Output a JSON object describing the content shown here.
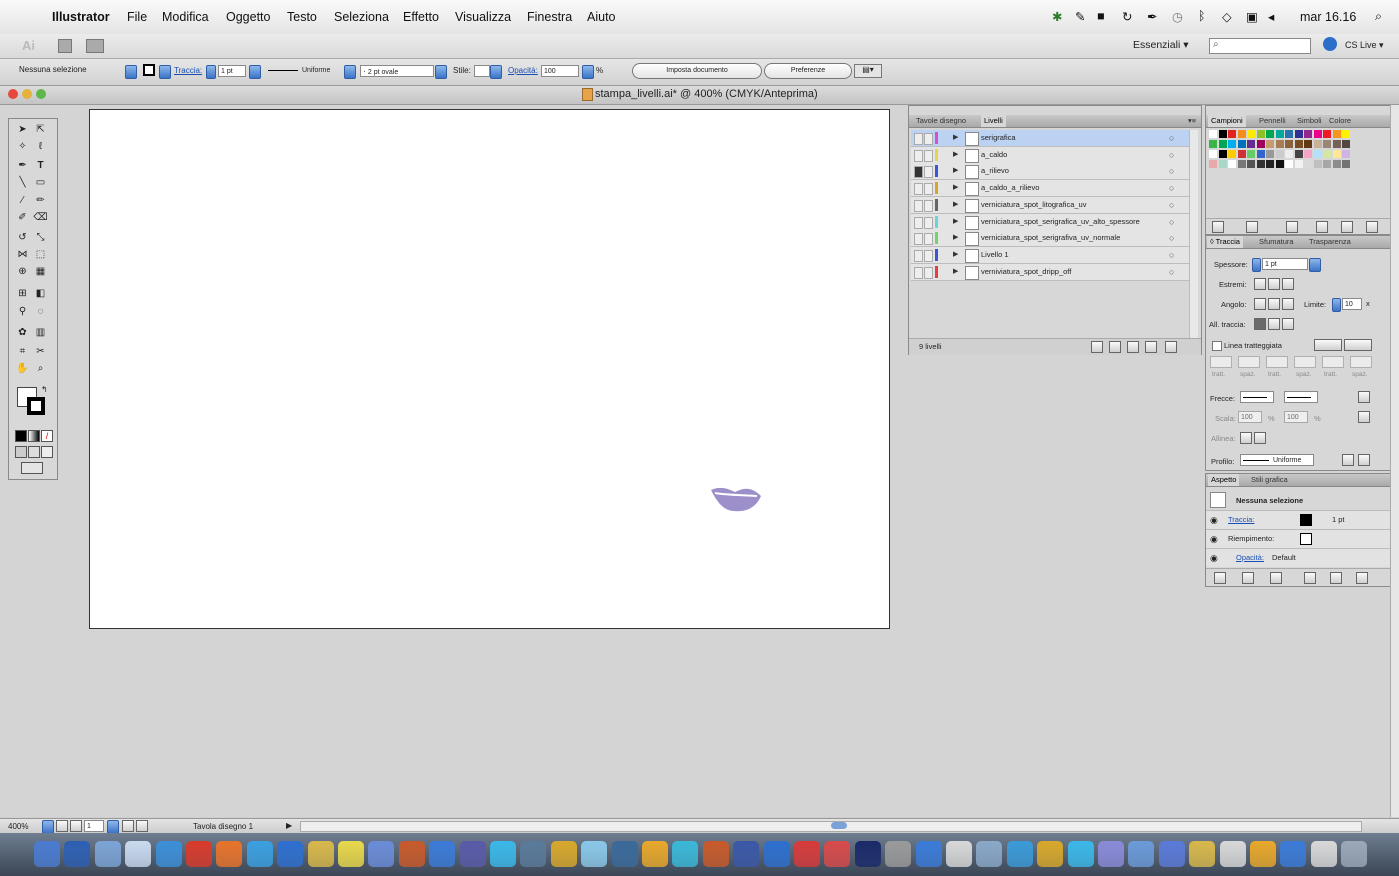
{
  "menubar": {
    "apple_icon": "apple-icon",
    "app": "Illustrator",
    "items": [
      "File",
      "Modifica",
      "Oggetto",
      "Testo",
      "Seleziona",
      "Effetto",
      "Visualizza",
      "Finestra",
      "Aiuto"
    ],
    "clock": "mar 16.16"
  },
  "appbar": {
    "app_logo": "Ai",
    "workspace": "Essenziali ▾",
    "search_placeholder": "",
    "cslive": "CS Live ▾"
  },
  "control": {
    "selection_status": "Nessuna selezione",
    "stroke_label": "Traccia:",
    "stroke_value": "1 pt",
    "stroke_profile": "Uniforme",
    "brush": "2 pt ovale",
    "style_label": "Stile:",
    "opacity_label": "Opacità:",
    "opacity_value": "100",
    "opacity_unit": "%",
    "document_setup": "Imposta documento",
    "preferences": "Preferenze"
  },
  "document": {
    "title": "stampa_livelli.ai* @ 400% (CMYK/Anteprima)"
  },
  "layers_panel": {
    "tabs": [
      "Tavole disegno",
      "Livelli"
    ],
    "active_tab": "Livelli",
    "layers": [
      {
        "name": "serigrafica",
        "color": "#d34fd3",
        "selected": true
      },
      {
        "name": "a_caldo",
        "color": "#e7d44a",
        "selected": false
      },
      {
        "name": "a_rilievo",
        "color": "#3a56d6",
        "selected": false
      },
      {
        "name": "a_caldo_a_rilievo",
        "color": "#d8a52a",
        "selected": false
      },
      {
        "name": "verniciatura_spot_litografica_uv",
        "color": "#666666",
        "selected": false
      },
      {
        "name": "verniciatura_spot_serigrafica_uv_alto_spessore",
        "color": "#6bd4d8",
        "selected": false
      },
      {
        "name": "verniciatura_spot_serigrafiva_uv_normale",
        "color": "#6fd46f",
        "selected": false
      },
      {
        "name": "Livello 1",
        "color": "#3a56d6",
        "selected": false
      },
      {
        "name": "verniviatura_spot_dripp_off",
        "color": "#e04040",
        "selected": false
      }
    ],
    "count": "9 livelli"
  },
  "swatches_panel": {
    "tabs": [
      "Campioni",
      "Pennelli",
      "Simboli",
      "Colore"
    ]
  },
  "stroke_panel": {
    "tabs": [
      "◊ Traccia",
      "Sfumatura",
      "Trasparenza"
    ],
    "weight_label": "Spessore:",
    "weight_value": "1 pt",
    "cap_label": "Estremi:",
    "corner_label": "Angolo:",
    "limit_label": "Limite:",
    "limit_value": "10",
    "limit_unit": "x",
    "align_label": "All. traccia:",
    "dashed_label": "Linea tratteggiata",
    "dash_fields": [
      "tratt.",
      "spaz.",
      "tratt.",
      "spaz.",
      "tratt.",
      "spaz."
    ],
    "arrows_label": "Frecce:",
    "scale_label": "Scala:",
    "scale_value1": "100",
    "scale_value2": "100",
    "pct": "%",
    "align2_label": "Allinea:",
    "profile_label": "Profilo:",
    "profile_value": "Uniforme"
  },
  "appearance_panel": {
    "tabs": [
      "Aspetto",
      "Stili grafica"
    ],
    "header": "Nessuna selezione",
    "stroke_label": "Traccia:",
    "stroke_value": "1 pt",
    "fill_label": "Riempimento:",
    "opacity_label": "Opacità:",
    "opacity_value": "Default"
  },
  "statusbar": {
    "zoom": "400%",
    "page": "1",
    "artboard_name": "Tavola disegno 1"
  },
  "artwork": {
    "lips_color": "#9d8fca"
  },
  "colors": {
    "selection_blue": "#bcd2f2",
    "accent_blue": "#3a73c8"
  }
}
